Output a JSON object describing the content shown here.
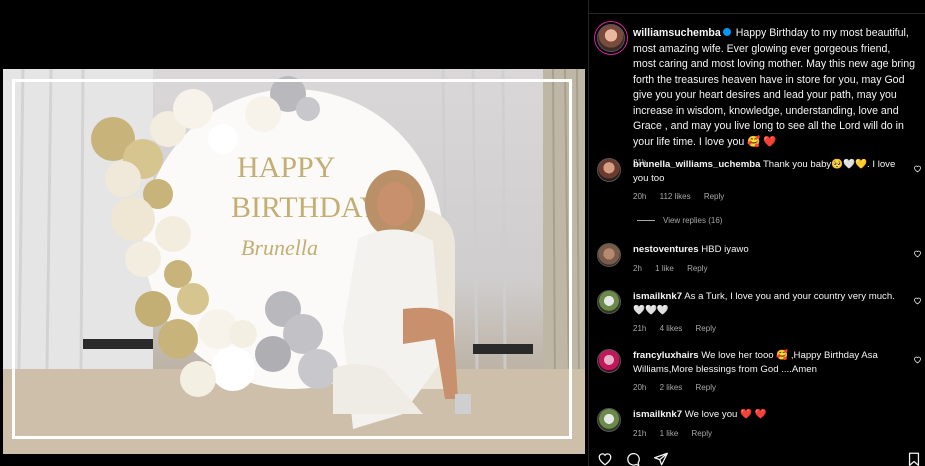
{
  "post": {
    "author": "williamsuchemba",
    "caption": "Happy Birthday to my most beautiful, most amazing wife. Ever glowing ever gorgeous friend, most caring and most loving mother. May this new age bring forth the treasures heaven have in store for you, may God give you your heart desires and lead your path, may you increase in wisdom, knowledge, understanding, love and Grace , and may you live long to see all the Lord will do in your life time. I love you",
    "caption_emoji": "🥰 ❤️",
    "time": "21h"
  },
  "photo": {
    "sign_line1": "HAPPY",
    "sign_line2": "BIRTHDAY",
    "sign_name": "Brunella",
    "colors": {
      "gold": "#c8b47a",
      "silver": "#b9b9bd",
      "cream": "#f3ede0",
      "dress": "#f4f2ef"
    }
  },
  "comments": [
    {
      "user": "brunella_williams_uchemba",
      "text": "Thank you baby🥺🤍💛. I love you too",
      "time": "20h",
      "likes": "112 likes",
      "reply": "Reply",
      "view_replies": "View replies (16)"
    },
    {
      "user": "nestoventures",
      "text": "HBD iyawo",
      "time": "2h",
      "likes": "1 like",
      "reply": "Reply"
    },
    {
      "user": "ismailknk7",
      "text": "As a Turk, I love you and your country very much. 🤍🤍🤍",
      "time": "21h",
      "likes": "4 likes",
      "reply": "Reply"
    },
    {
      "user": "francyluxhairs",
      "text": "We love her tooo 🥰 ,Happy Birthday Asa Williams,More blessings from God ....Amen",
      "time": "20h",
      "likes": "2 likes",
      "reply": "Reply"
    },
    {
      "user": "ismailknk7",
      "text": "We love you",
      "emoji": "❤️ ❤️",
      "time": "21h",
      "likes": "1 like",
      "reply": "Reply"
    }
  ],
  "icons": [
    "heart-icon",
    "comment-icon",
    "share-icon",
    "bookmark-icon"
  ]
}
